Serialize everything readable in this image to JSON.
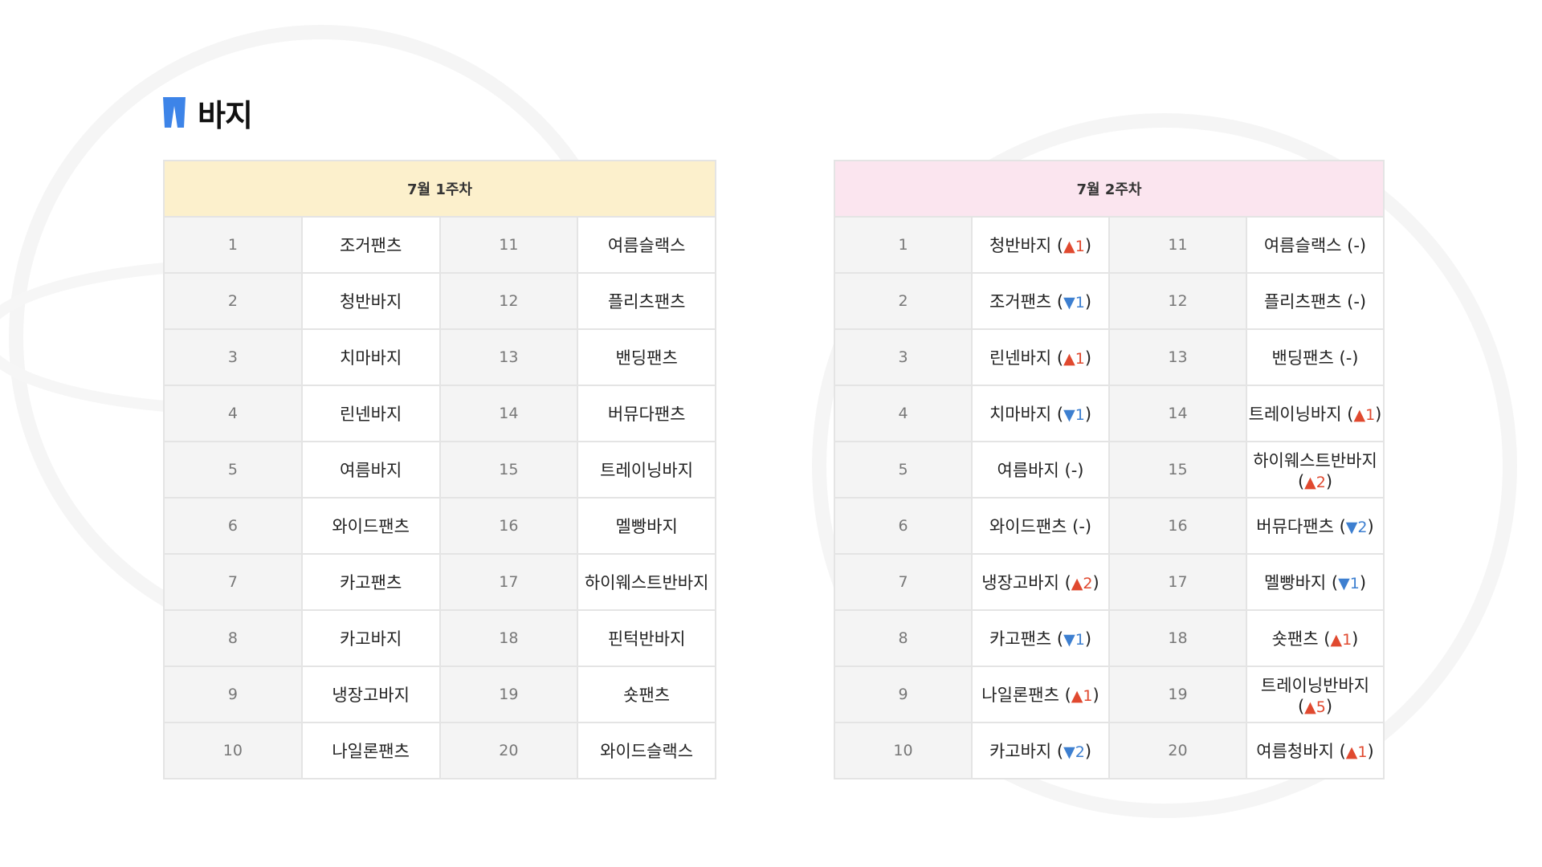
{
  "title": "바지",
  "week1": {
    "header": "7월 1주차",
    "rows": [
      {
        "l_rank": "1",
        "l_name": "조거팬츠",
        "r_rank": "11",
        "r_name": "여름슬랙스"
      },
      {
        "l_rank": "2",
        "l_name": "청반바지",
        "r_rank": "12",
        "r_name": "플리츠팬츠"
      },
      {
        "l_rank": "3",
        "l_name": "치마바지",
        "r_rank": "13",
        "r_name": "밴딩팬츠"
      },
      {
        "l_rank": "4",
        "l_name": "린넨바지",
        "r_rank": "14",
        "r_name": "버뮤다팬츠"
      },
      {
        "l_rank": "5",
        "l_name": "여름바지",
        "r_rank": "15",
        "r_name": "트레이닝바지"
      },
      {
        "l_rank": "6",
        "l_name": "와이드팬츠",
        "r_rank": "16",
        "r_name": "멜빵바지"
      },
      {
        "l_rank": "7",
        "l_name": "카고팬츠",
        "r_rank": "17",
        "r_name": "하이웨스트반바지"
      },
      {
        "l_rank": "8",
        "l_name": "카고바지",
        "r_rank": "18",
        "r_name": "핀턱반바지"
      },
      {
        "l_rank": "9",
        "l_name": "냉장고바지",
        "r_rank": "19",
        "r_name": "숏팬츠"
      },
      {
        "l_rank": "10",
        "l_name": "나일론팬츠",
        "r_rank": "20",
        "r_name": "와이드슬랙스"
      }
    ]
  },
  "week2": {
    "header": "7월 2주차",
    "rows": [
      {
        "l_rank": "1",
        "l_name": "청반바지",
        "l_dir": "up",
        "l_arrow": "▲",
        "l_delta": "1",
        "r_rank": "11",
        "r_name": "여름슬랙스",
        "r_dir": "none",
        "r_arrow": "",
        "r_delta": "-"
      },
      {
        "l_rank": "2",
        "l_name": "조거팬츠",
        "l_dir": "down",
        "l_arrow": "▼",
        "l_delta": "1",
        "r_rank": "12",
        "r_name": "플리츠팬츠",
        "r_dir": "none",
        "r_arrow": "",
        "r_delta": "-"
      },
      {
        "l_rank": "3",
        "l_name": "린넨바지",
        "l_dir": "up",
        "l_arrow": "▲",
        "l_delta": "1",
        "r_rank": "13",
        "r_name": "밴딩팬츠",
        "r_dir": "none",
        "r_arrow": "",
        "r_delta": "-"
      },
      {
        "l_rank": "4",
        "l_name": "치마바지",
        "l_dir": "down",
        "l_arrow": "▼",
        "l_delta": "1",
        "r_rank": "14",
        "r_name": "트레이닝바지",
        "r_dir": "up",
        "r_arrow": "▲",
        "r_delta": "1"
      },
      {
        "l_rank": "5",
        "l_name": "여름바지",
        "l_dir": "none",
        "l_arrow": "",
        "l_delta": "-",
        "r_rank": "15",
        "r_name": "하이웨스트반바지",
        "r_dir": "up",
        "r_arrow": "▲",
        "r_delta": "2"
      },
      {
        "l_rank": "6",
        "l_name": "와이드팬츠",
        "l_dir": "none",
        "l_arrow": "",
        "l_delta": "-",
        "r_rank": "16",
        "r_name": "버뮤다팬츠",
        "r_dir": "down",
        "r_arrow": "▼",
        "r_delta": "2"
      },
      {
        "l_rank": "7",
        "l_name": "냉장고바지",
        "l_dir": "up",
        "l_arrow": "▲",
        "l_delta": "2",
        "r_rank": "17",
        "r_name": "멜빵바지",
        "r_dir": "down",
        "r_arrow": "▼",
        "r_delta": "1"
      },
      {
        "l_rank": "8",
        "l_name": "카고팬츠",
        "l_dir": "down",
        "l_arrow": "▼",
        "l_delta": "1",
        "r_rank": "18",
        "r_name": "숏팬츠",
        "r_dir": "up",
        "r_arrow": "▲",
        "r_delta": "1"
      },
      {
        "l_rank": "9",
        "l_name": "나일론팬츠",
        "l_dir": "up",
        "l_arrow": "▲",
        "l_delta": "1",
        "r_rank": "19",
        "r_name": "트레이닝반바지",
        "r_dir": "up",
        "r_arrow": "▲",
        "r_delta": "5"
      },
      {
        "l_rank": "10",
        "l_name": "카고바지",
        "l_dir": "down",
        "l_arrow": "▼",
        "l_delta": "2",
        "r_rank": "20",
        "r_name": "여름청바지",
        "r_dir": "up",
        "r_arrow": "▲",
        "r_delta": "1"
      }
    ]
  },
  "colors": {
    "up": "#e0492f",
    "down": "#3d7fd0",
    "icon": "#3d84e8",
    "week1_header_bg": "#fcf0cc",
    "week2_header_bg": "#fbe5ef"
  },
  "icons": {
    "title": "pants-icon",
    "up": "triangle-up-icon",
    "down": "triangle-down-icon"
  }
}
